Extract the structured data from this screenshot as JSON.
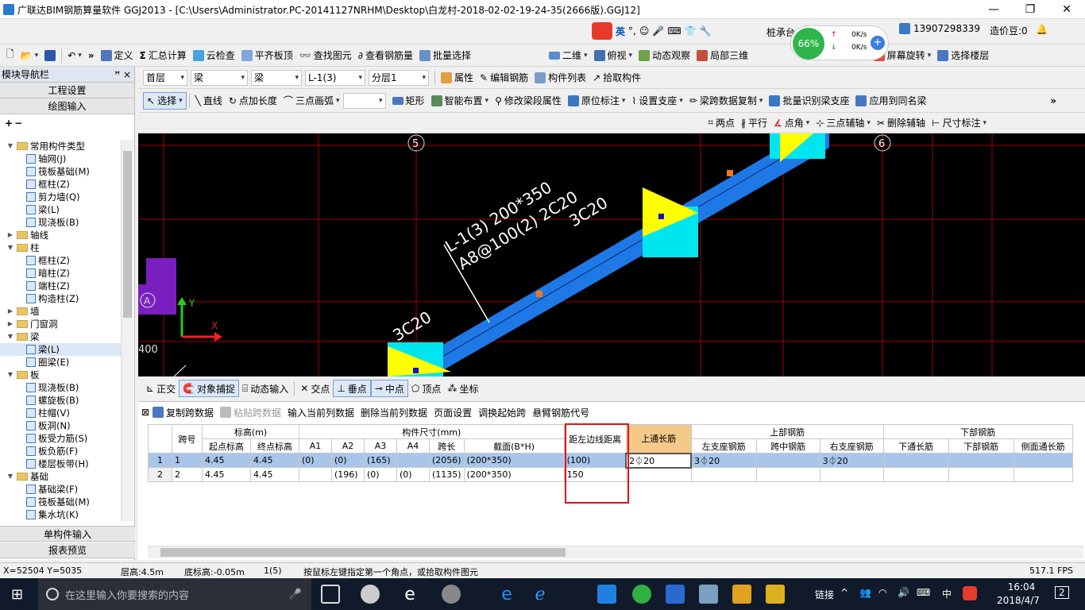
{
  "title": "广联达BIM钢筋算量软件 GGJ2013 - [C:\\Users\\Administrator.PC-20141127NRHM\\Desktop\\白龙村-2018-02-02-19-24-35(2666版).GGJ12]",
  "ime": {
    "lang": "英",
    "user": "桩承台",
    "phone": "13907298339",
    "bean": "造价豆:0"
  },
  "net": {
    "pct": "66%",
    "up": "0K/s",
    "down": "0K/s"
  },
  "tb1": [
    "定义",
    "汇总计算",
    "云检查",
    "平齐板顶",
    "查找图元",
    "查看钢筋量",
    "批量选择",
    "二维",
    "俯视",
    "动态观察",
    "局部三维",
    "平移",
    "屏幕旋转",
    "选择楼层"
  ],
  "tb2": {
    "floor": "首层",
    "cat1": "梁",
    "cat2": "梁",
    "comp": "L-1(3)",
    "layer": "分层1",
    "items": [
      "属性",
      "编辑钢筋",
      "构件列表",
      "拾取构件"
    ]
  },
  "tb3": [
    "选择",
    "直线",
    "点加长度",
    "三点画弧",
    "矩形",
    "智能布置",
    "修改梁段属性",
    "原位标注",
    "设置支座",
    "梁跨数据复制",
    "批量识别梁支座",
    "应用到同名梁"
  ],
  "tb4": [
    "两点",
    "平行",
    "点角",
    "三点辅轴",
    "删除辅轴",
    "尺寸标注"
  ],
  "nav": {
    "title": "模块导航栏",
    "pin": "ꟸ ×",
    "s1": "工程设置",
    "s2": "绘图输入",
    "s3": "单构件输入",
    "s4": "报表预览",
    "tree": [
      {
        "l": 0,
        "t": "常用构件类型",
        "f": true,
        "e": "▼"
      },
      {
        "l": 1,
        "t": "轴网(J)"
      },
      {
        "l": 1,
        "t": "筏板基础(M)"
      },
      {
        "l": 1,
        "t": "框柱(Z)"
      },
      {
        "l": 1,
        "t": "剪力墙(Q)"
      },
      {
        "l": 1,
        "t": "梁(L)"
      },
      {
        "l": 1,
        "t": "现浇板(B)"
      },
      {
        "l": 0,
        "t": "轴线",
        "f": true,
        "e": "▶"
      },
      {
        "l": 0,
        "t": "柱",
        "f": true,
        "e": "▼"
      },
      {
        "l": 1,
        "t": "框柱(Z)"
      },
      {
        "l": 1,
        "t": "暗柱(Z)"
      },
      {
        "l": 1,
        "t": "端柱(Z)"
      },
      {
        "l": 1,
        "t": "构造柱(Z)"
      },
      {
        "l": 0,
        "t": "墙",
        "f": true,
        "e": "▶"
      },
      {
        "l": 0,
        "t": "门窗洞",
        "f": true,
        "e": "▶"
      },
      {
        "l": 0,
        "t": "梁",
        "f": true,
        "e": "▼"
      },
      {
        "l": 1,
        "t": "梁(L)",
        "sel": true
      },
      {
        "l": 1,
        "t": "圈梁(E)"
      },
      {
        "l": 0,
        "t": "板",
        "f": true,
        "e": "▼"
      },
      {
        "l": 1,
        "t": "现浇板(B)"
      },
      {
        "l": 1,
        "t": "螺旋板(B)"
      },
      {
        "l": 1,
        "t": "柱帽(V)"
      },
      {
        "l": 1,
        "t": "板洞(N)"
      },
      {
        "l": 1,
        "t": "板受力筋(S)"
      },
      {
        "l": 1,
        "t": "板负筋(F)"
      },
      {
        "l": 1,
        "t": "楼层板带(H)"
      },
      {
        "l": 0,
        "t": "基础",
        "f": true,
        "e": "▼"
      },
      {
        "l": 1,
        "t": "基础梁(F)"
      },
      {
        "l": 1,
        "t": "筏板基础(M)"
      },
      {
        "l": 1,
        "t": "集水坑(K)"
      }
    ]
  },
  "canvas": {
    "axis5": "5",
    "axis6": "6",
    "axisA": "A",
    "beamLabel1": "L-1(3) 200*350",
    "beamLabel2": "A8@100(2) 2C20",
    "top3c20": "3C20",
    "left3c20": "3C20",
    "coord400": "400",
    "yLbl": "Y",
    "xLbl": "X"
  },
  "snap": [
    "正交",
    "对象捕捉",
    "动态输入",
    "交点",
    "垂点",
    "中点",
    "顶点",
    "坐标"
  ],
  "grid": {
    "toolbar": [
      "复制跨数据",
      "粘贴跨数据",
      "输入当前列数据",
      "删除当前列数据",
      "页面设置",
      "调换起始跨",
      "悬臂钢筋代号"
    ],
    "h1": [
      "跨号",
      "标高(m)",
      "构件尺寸(mm)",
      "距左边线距离",
      "上通长筋",
      "上部钢筋",
      "下部钢筋"
    ],
    "h2": [
      "起点标高",
      "终点标高",
      "A1",
      "A2",
      "A3",
      "A4",
      "跨长",
      "截面(B*H)",
      "左支座钢筋",
      "跨中钢筋",
      "右支座钢筋",
      "下通长筋",
      "下部钢筋",
      "侧面通长筋"
    ],
    "rows": [
      [
        "1",
        "1",
        "4.45",
        "4.45",
        "(0)",
        "(0)",
        "(165)",
        "",
        "(2056)",
        "(200*350)",
        "(100)",
        "2⏀20",
        "3⏀20",
        "",
        "3⏀20",
        "",
        "",
        ""
      ],
      [
        "2",
        "2",
        "4.45",
        "4.45",
        "",
        "(196)",
        "(0)",
        "(0)",
        "(1135)",
        "(200*350)",
        "150",
        "",
        "",
        "",
        "",
        "",
        "",
        ""
      ]
    ]
  },
  "status": {
    "xy": "X=52504 Y=5035",
    "floorH": "层高:4.5m",
    "bottom": "底标高:-0.05m",
    "cnt": "1(5)",
    "hint": "按鼠标左键指定第一个角点，或拾取构件图元",
    "fps": "517.1 FPS"
  },
  "taskbar": {
    "search": "在这里输入你要搜索的内容",
    "link": "链接",
    "lang": "中",
    "time": "16:04",
    "date": "2018/4/7",
    "notif": "2"
  },
  "colors": {
    "beam": "#1e78e6",
    "support": "#ffff00",
    "cyan": "#00e5ee",
    "grid": "#b00000",
    "purple": "#7a1fbf"
  }
}
